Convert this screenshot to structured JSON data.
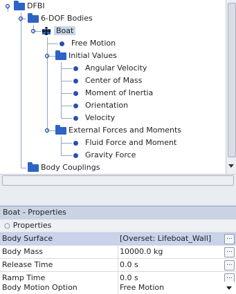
{
  "tree": {
    "nodes": [
      {
        "label": "DFBI"
      },
      {
        "label": "6-DOF Bodies"
      },
      {
        "label": "Boat"
      },
      {
        "label": "Free Motion"
      },
      {
        "label": "Initial Values"
      },
      {
        "label": "Angular Velocity"
      },
      {
        "label": "Center of Mass"
      },
      {
        "label": "Moment of Inertia"
      },
      {
        "label": "Orientation"
      },
      {
        "label": "Velocity"
      },
      {
        "label": "External Forces and Moments"
      },
      {
        "label": "Fluid Force and Moment"
      },
      {
        "label": "Gravity Force"
      },
      {
        "label": "Body Couplings"
      }
    ]
  },
  "properties_panel": {
    "title": "Boat - Properties",
    "section": "Properties",
    "rows": [
      {
        "key": "Body Surface",
        "value": "[Overset: Lifeboat_Wall]"
      },
      {
        "key": "Body Mass",
        "value": "10000.0 kg"
      },
      {
        "key": "Release Time",
        "value": "0.0 s"
      },
      {
        "key": "Ramp Time",
        "value": "0.0 s"
      },
      {
        "key": "Body Motion Option",
        "value": "Free Motion"
      }
    ],
    "ellipsis": "..."
  },
  "icons": [
    "folder-icon",
    "leaf-dot-icon",
    "expander-icon",
    "move-cursor-icon",
    "pin-icon",
    "menu-arrow-icon",
    "close-icon",
    "dropdown-arrow-icon"
  ],
  "colors": {
    "folder": "#2d63c5",
    "selected": "#c9d6ea",
    "panel_title": "#c9d3e3"
  }
}
